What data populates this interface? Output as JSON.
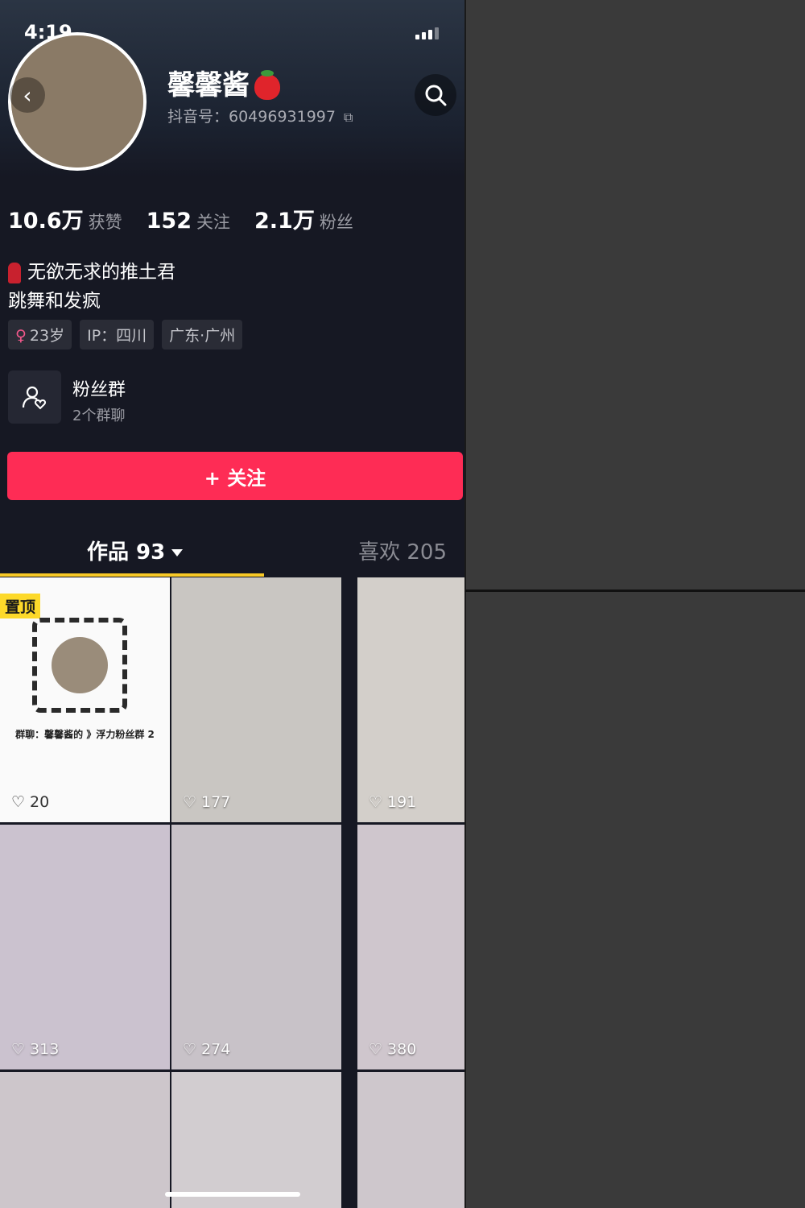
{
  "status_bar": {
    "time": "4:19"
  },
  "profile": {
    "nickname": "馨馨酱",
    "douyin_id": "抖音号：60496931997"
  },
  "stats": [
    {
      "value": "10.6万",
      "label": "获赞"
    },
    {
      "value": "152",
      "label": "关注"
    },
    {
      "value": "2.1万",
      "label": "粉丝"
    }
  ],
  "bio": {
    "line1": "无欲无求的推土君",
    "line2": "跳舞和发疯"
  },
  "tags": [
    {
      "text": "23岁",
      "gender_symbol": "♀"
    },
    {
      "text": "IP：四川"
    },
    {
      "text": "广东·广州"
    }
  ],
  "fan_group": {
    "title": "粉丝群",
    "subtitle": "2个群聊"
  },
  "follow_button": {
    "label": "+ 关注"
  },
  "tabs": {
    "works": "作品 93",
    "likes": "喜欢 205"
  },
  "pinned_label": "置顶",
  "qr_caption": "群聊：馨馨酱的 》浮力粉丝群 2",
  "videos": [
    {
      "likes": "20",
      "type": "qr",
      "pinned": true
    },
    {
      "likes": "177"
    },
    {
      "likes": "191"
    },
    {
      "likes": "313"
    },
    {
      "likes": "274"
    },
    {
      "likes": "380"
    },
    {
      "likes": ""
    },
    {
      "likes": ""
    },
    {
      "likes": ""
    }
  ],
  "colors": {
    "background": "#161823",
    "follow_button": "#fe2c55",
    "tab_indicator": "#f8c927",
    "pinned_badge": "#fdd92a"
  }
}
